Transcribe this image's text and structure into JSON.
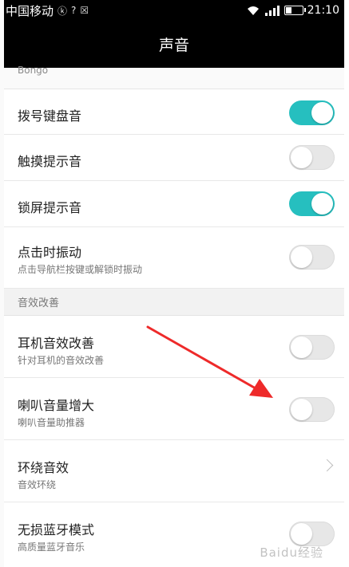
{
  "status_bar": {
    "carrier": "中国移动",
    "small_icons": [
      "ⓚ",
      "?",
      "☒"
    ],
    "time": "21:10"
  },
  "header": {
    "title": "声音"
  },
  "partial_row": {
    "label": "Bongo"
  },
  "settings": [
    {
      "title": "拨号键盘音",
      "subtitle": "",
      "state": "on"
    },
    {
      "title": "触摸提示音",
      "subtitle": "",
      "state": "off"
    },
    {
      "title": "锁屏提示音",
      "subtitle": "",
      "state": "on"
    },
    {
      "title": "点击时振动",
      "subtitle": "点击导航栏按键或解锁时振动",
      "state": "off"
    }
  ],
  "section": {
    "title": "音效改善"
  },
  "enhance_settings": [
    {
      "title": "耳机音效改善",
      "subtitle": "针对耳机的音效改善",
      "state": "off"
    },
    {
      "title": "喇叭音量增大",
      "subtitle": "喇叭音量助推器",
      "state": "off"
    },
    {
      "title": "环绕音效",
      "subtitle": "音效环绕",
      "state": "chevron"
    },
    {
      "title": "无损蓝牙模式",
      "subtitle": "高质量蓝牙音乐",
      "state": "off"
    }
  ],
  "colors": {
    "toggle_on": "#26bfbf",
    "annotation_arrow": "#ee2a2a",
    "header_bg": "#000000"
  },
  "watermark": "Baidu经验"
}
